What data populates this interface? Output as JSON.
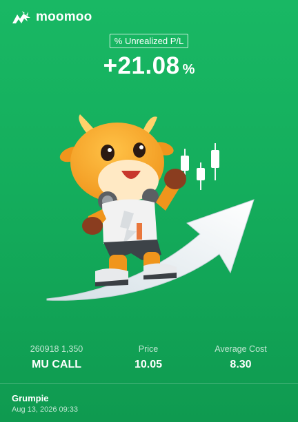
{
  "brand": {
    "name": "moomoo",
    "logo_icon": "bull-logo-icon"
  },
  "pl": {
    "label": "% Unrealized P/L",
    "value": "+21.08",
    "unit": "%"
  },
  "illustration": {
    "icon": "bull-mascot-riding-up-arrow"
  },
  "stats": [
    {
      "label": "260918 1,350",
      "value": "MU CALL"
    },
    {
      "label": "Price",
      "value": "10.05"
    },
    {
      "label": "Average Cost",
      "value": "8.30"
    }
  ],
  "footer": {
    "user": "Grumpie",
    "timestamp": "Aug 13, 2026 09:33"
  },
  "colors": {
    "background": "#14ad5c",
    "text": "#ffffff",
    "mascot": "#f5a623",
    "arrow": "#eef2f4"
  }
}
